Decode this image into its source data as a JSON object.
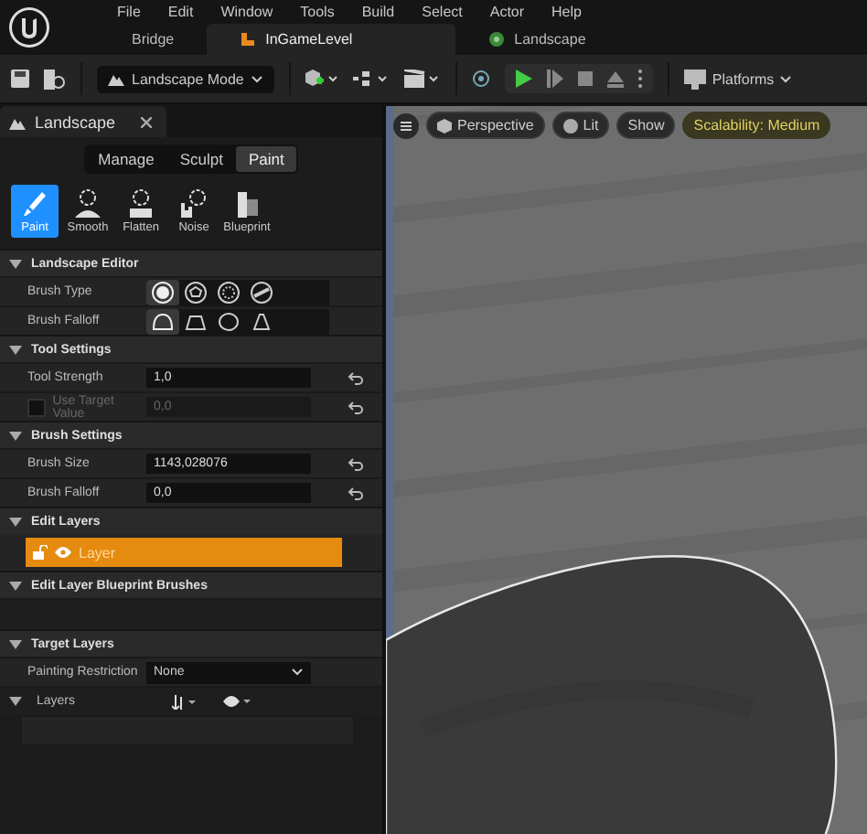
{
  "menu": [
    "File",
    "Edit",
    "Window",
    "Tools",
    "Build",
    "Select",
    "Actor",
    "Help"
  ],
  "doc_tabs": [
    {
      "label": "Bridge",
      "selected": false,
      "kind": "plain"
    },
    {
      "label": "InGameLevel",
      "selected": true,
      "kind": "level"
    },
    {
      "label": "Landscape",
      "selected": false,
      "kind": "landscape"
    }
  ],
  "toolbar": {
    "mode": "Landscape Mode",
    "platforms": "Platforms"
  },
  "panel": {
    "title": "Landscape",
    "modes": [
      {
        "label": "Manage",
        "selected": false
      },
      {
        "label": "Sculpt",
        "selected": false
      },
      {
        "label": "Paint",
        "selected": true
      }
    ],
    "tools": [
      {
        "label": "Paint",
        "selected": true,
        "kind": "brush"
      },
      {
        "label": "Smooth",
        "selected": false,
        "kind": "smooth"
      },
      {
        "label": "Flatten",
        "selected": false,
        "kind": "flatten"
      },
      {
        "label": "Noise",
        "selected": false,
        "kind": "noise"
      },
      {
        "label": "Blueprint",
        "selected": false,
        "kind": "blueprint"
      }
    ],
    "sections": [
      {
        "title": "Landscape Editor",
        "rows": [
          {
            "kind": "icons",
            "label": "Brush Type",
            "options": [
              {
                "kind": "circle",
                "selected": true
              },
              {
                "kind": "alpha",
                "selected": false
              },
              {
                "kind": "pattern",
                "selected": false
              },
              {
                "kind": "component",
                "selected": false
              }
            ]
          },
          {
            "kind": "icons",
            "label": "Brush Falloff",
            "options": [
              {
                "kind": "smooth",
                "selected": true
              },
              {
                "kind": "linear",
                "selected": false
              },
              {
                "kind": "spherical",
                "selected": false
              },
              {
                "kind": "tip",
                "selected": false
              }
            ]
          }
        ]
      },
      {
        "title": "Tool Settings",
        "rows": [
          {
            "kind": "number",
            "label": "Tool Strength",
            "value": "1,0",
            "disabled": false
          },
          {
            "kind": "number",
            "label": "Use Target Value",
            "value": "0,0",
            "disabled": true,
            "checked": false
          }
        ]
      },
      {
        "title": "Brush Settings",
        "rows": [
          {
            "kind": "number",
            "label": "Brush Size",
            "value": "1143,028076",
            "disabled": false
          },
          {
            "kind": "number",
            "label": "Brush Falloff",
            "value": "0,0",
            "disabled": false
          }
        ]
      },
      {
        "title": "Edit Layers",
        "rows": [
          {
            "kind": "layer",
            "label": "Layer",
            "selected": true
          }
        ]
      },
      {
        "title": "Edit Layer Blueprint Brushes",
        "rows": [
          {
            "kind": "empty"
          }
        ]
      },
      {
        "title": "Target Layers",
        "rows": [
          {
            "kind": "dropdown",
            "label": "Painting Restriction",
            "value": "None"
          },
          {
            "kind": "layers",
            "label": "Layers"
          },
          {
            "kind": "list"
          }
        ]
      }
    ]
  },
  "viewport": {
    "buttons": [
      {
        "label": "Perspective",
        "kind": "perspective"
      },
      {
        "label": "Lit",
        "kind": "lit"
      },
      {
        "label": "Show",
        "kind": "plain"
      },
      {
        "label": "Scalability: Medium",
        "kind": "scalability"
      }
    ]
  }
}
